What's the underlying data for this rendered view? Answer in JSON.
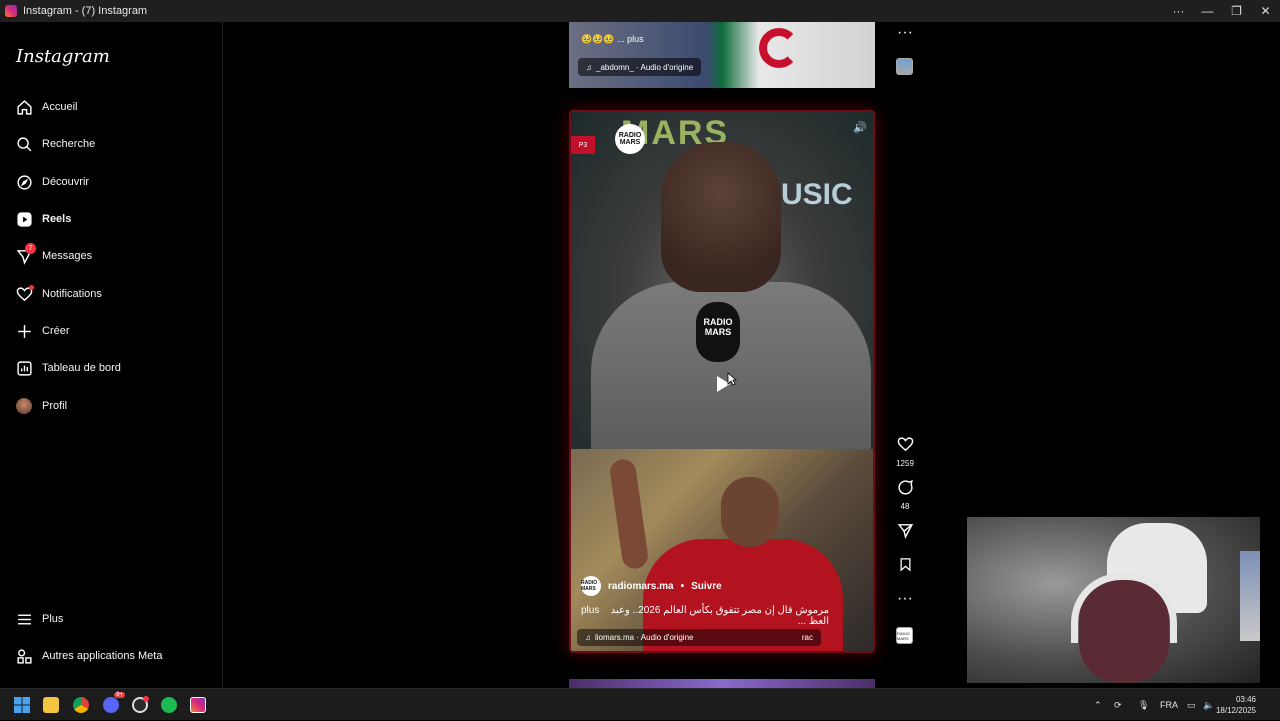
{
  "window": {
    "title": "Instagram - (7) Instagram",
    "controls": {
      "more": "···",
      "minimize": "—",
      "restore": "❐",
      "close": "✕"
    }
  },
  "sidebar": {
    "logo": "Instagram",
    "items": [
      {
        "label": "Accueil",
        "icon": "home-icon"
      },
      {
        "label": "Recherche",
        "icon": "search-icon"
      },
      {
        "label": "Découvrir",
        "icon": "compass-icon"
      },
      {
        "label": "Reels",
        "icon": "reels-icon",
        "active": true
      },
      {
        "label": "Messages",
        "icon": "messenger-icon",
        "badge": "7"
      },
      {
        "label": "Notifications",
        "icon": "heart-icon"
      },
      {
        "label": "Créer",
        "icon": "plus-icon"
      },
      {
        "label": "Tableau de bord",
        "icon": "dashboard-icon"
      },
      {
        "label": "Profil",
        "icon": "avatar"
      }
    ],
    "bottom": [
      {
        "label": "Plus",
        "icon": "menu-icon"
      },
      {
        "label": "Autres applications Meta",
        "icon": "meta-apps-icon"
      }
    ]
  },
  "previous_reel": {
    "emojis": "🥹🥹🥹 ... plus",
    "audio": "_abdomn_ · Audio d'origine"
  },
  "reel": {
    "channel_logo": "RADIO MARS",
    "tag": "P3",
    "bg_text_1": "MARS",
    "bg_text_2": "USIC",
    "mic_logo": "RADIO MARS",
    "account": "radiomars.ma",
    "separator": "•",
    "follow": "Suivre",
    "caption": "مرموش قال إن مصر تتفوق بكأس العالم 2026.. وعبد العظ ...",
    "caption_more": "plus",
    "audio": "liomars.ma · Audio d'origine",
    "audio_tail": "rac",
    "avatar_text": "RADIO MARS"
  },
  "actions": {
    "likes": "1259",
    "comments": "48",
    "more": "···",
    "top_more": "···"
  },
  "taskbar": {
    "language": "FRA",
    "time": "03:46",
    "date": "18/12/2025",
    "discord_badge": "9+"
  },
  "colors": {
    "background": "#000000",
    "badge": "#ff3040",
    "reel_glow": "#6e0d18"
  }
}
